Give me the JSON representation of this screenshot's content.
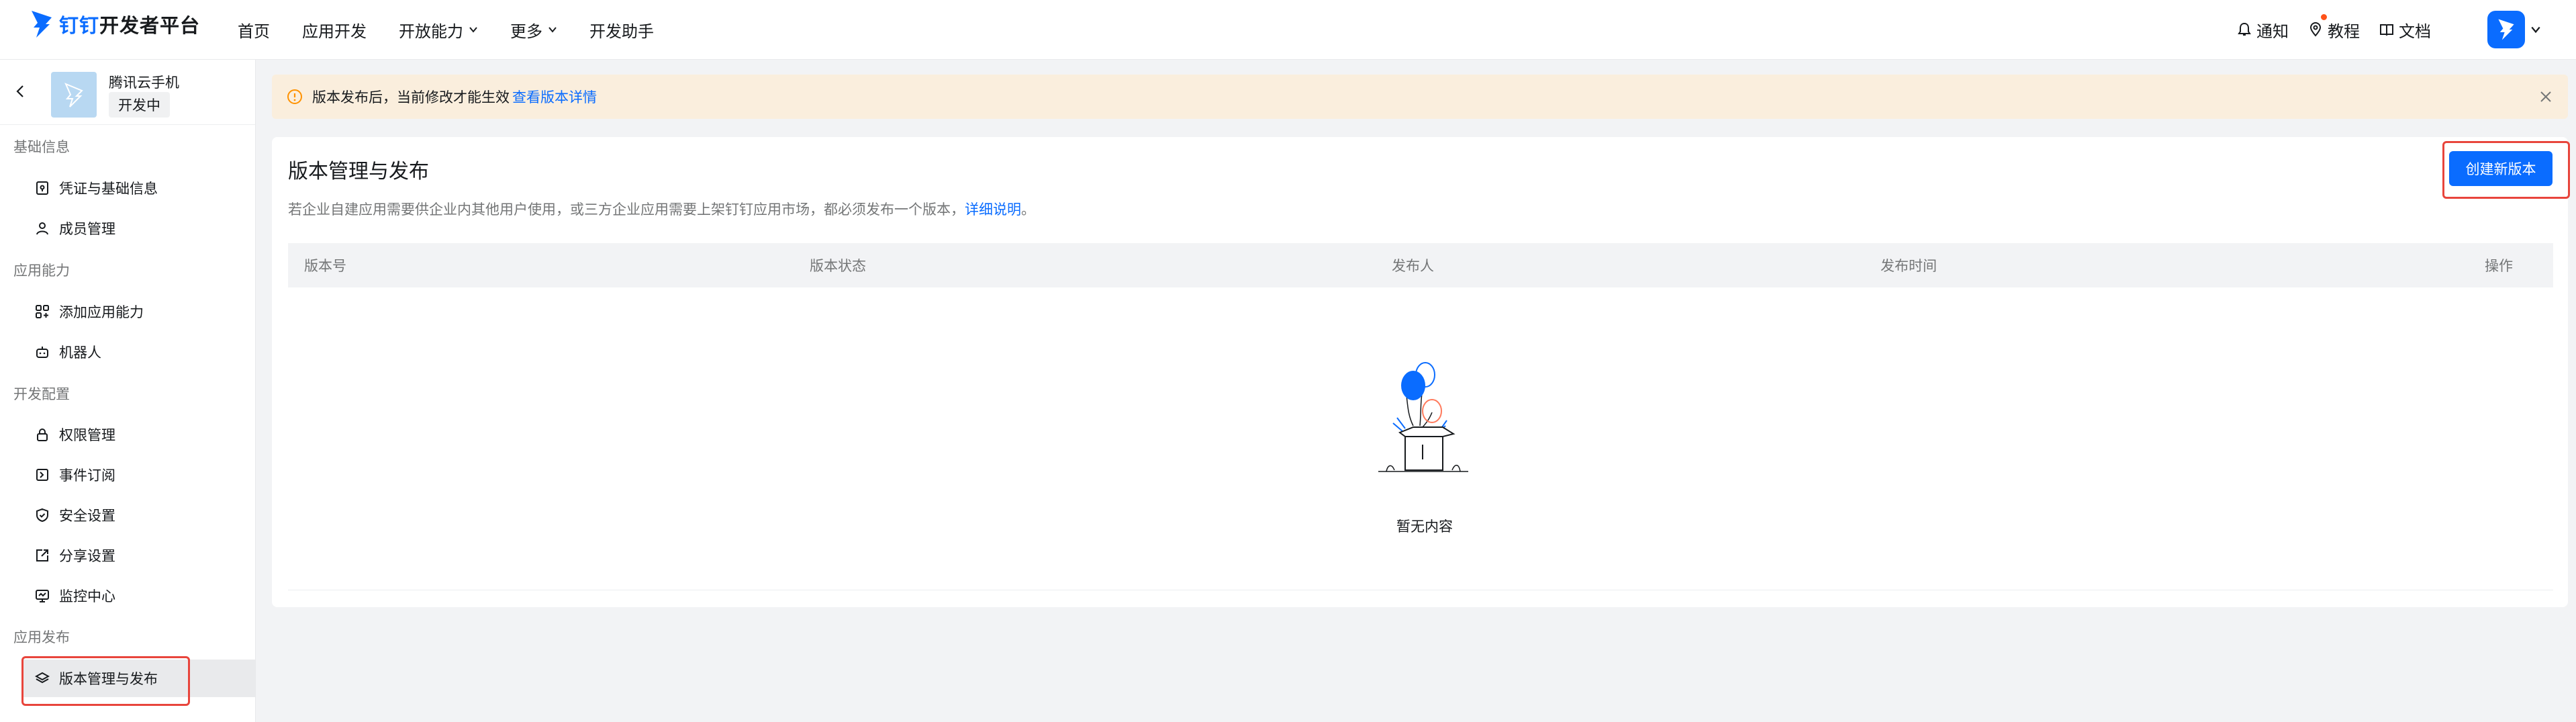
{
  "header": {
    "brand": "钉钉",
    "brand_suffix": "开发者平台",
    "nav": [
      {
        "label": "首页"
      },
      {
        "label": "应用开发"
      },
      {
        "label": "开放能力"
      },
      {
        "label": "更多"
      },
      {
        "label": "开发助手"
      }
    ],
    "tools": {
      "notify": "通知",
      "tutorial": "教程",
      "docs": "文档"
    }
  },
  "sidebar": {
    "app_name": "腾讯云手机",
    "app_status": "开发中",
    "groups": [
      {
        "label": "基础信息",
        "items": [
          "凭证与基础信息",
          "成员管理"
        ]
      },
      {
        "label": "应用能力",
        "items": [
          "添加应用能力",
          "机器人"
        ]
      },
      {
        "label": "开发配置",
        "items": [
          "权限管理",
          "事件订阅",
          "安全设置",
          "分享设置",
          "监控中心"
        ]
      },
      {
        "label": "应用发布",
        "items": [
          "版本管理与发布"
        ]
      }
    ]
  },
  "notice": {
    "text": "版本发布后，当前修改才能生效",
    "link": "查看版本详情"
  },
  "main": {
    "title": "版本管理与发布",
    "description": "若企业自建应用需要供企业内其他用户使用，或三方企业应用需要上架钉钉应用市场，都必须发布一个版本，",
    "description_link": "详细说明",
    "description_end": "。",
    "create_button": "创建新版本",
    "columns": [
      "版本号",
      "版本状态",
      "发布人",
      "发布时间",
      "操作"
    ],
    "empty_text": "暂无内容"
  },
  "colors": {
    "accent": "#0a6cff",
    "highlight": "#e8453c",
    "notice_bg": "#faeedd"
  }
}
